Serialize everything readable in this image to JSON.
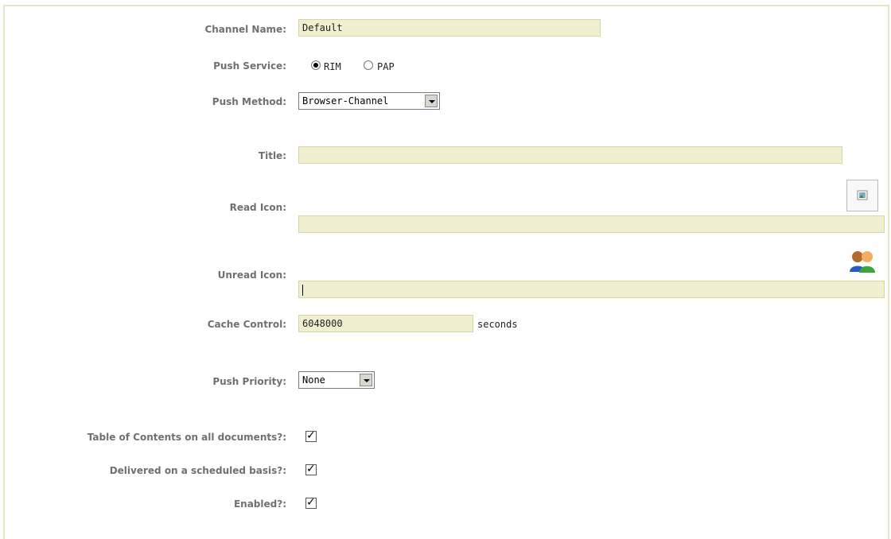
{
  "form": {
    "channel_name": {
      "label": "Channel Name:",
      "value": "Default"
    },
    "push_service": {
      "label": "Push Service:",
      "options": [
        "RIM",
        "PAP"
      ],
      "selected": "RIM"
    },
    "push_method": {
      "label": "Push Method:",
      "value": "Browser-Channel"
    },
    "title": {
      "label": "Title:",
      "value": ""
    },
    "read_icon": {
      "label": "Read Icon:",
      "value": "",
      "icon": "image-picker-icon"
    },
    "unread_icon": {
      "label": "Unread Icon:",
      "value": "",
      "icon": "users-icon"
    },
    "cache_control": {
      "label": "Cache Control:",
      "value": "6048000",
      "unit": "seconds"
    },
    "push_priority": {
      "label": "Push Priority:",
      "value": "None"
    },
    "toc_all_docs": {
      "label": "Table of Contents on all documents?:",
      "checked": true
    },
    "scheduled": {
      "label": "Delivered on a scheduled basis?:",
      "checked": true
    },
    "enabled": {
      "label": "Enabled?:",
      "checked": true
    }
  }
}
